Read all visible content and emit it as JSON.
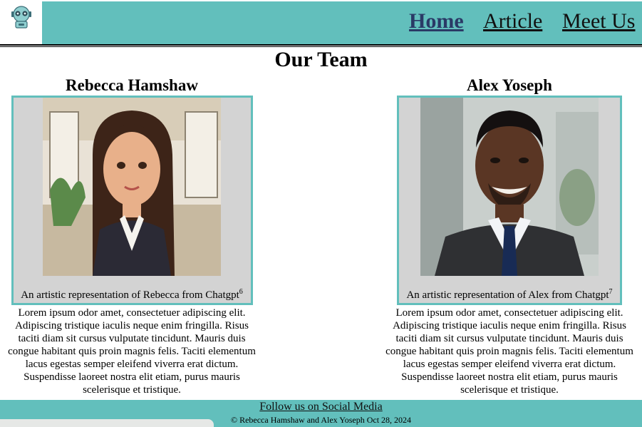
{
  "nav": {
    "items": [
      {
        "label": "Home",
        "active": true
      },
      {
        "label": "Article",
        "active": false
      },
      {
        "label": "Meet Us",
        "active": false
      }
    ]
  },
  "logo_icon": "robot-icon",
  "page_title": "Our Team",
  "members": [
    {
      "name": "Rebecca Hamshaw",
      "caption": "An artistic representation of Rebecca from Chatgpt",
      "footnote": "6",
      "bio": "Lorem ipsum odor amet, consectetuer adipiscing elit. Adipiscing tristique iaculis neque enim fringilla. Risus taciti diam sit cursus vulputate tincidunt. Mauris duis congue habitant quis proin magnis felis. Taciti elementum lacus egestas semper eleifend viverra erat dictum. Suspendisse laoreet nostra elit etiam, purus mauris scelerisque et tristique."
    },
    {
      "name": "Alex Yoseph",
      "caption": "An artistic representation of Alex from Chatgpt",
      "footnote": "7",
      "bio": "Lorem ipsum odor amet, consectetuer adipiscing elit. Adipiscing tristique iaculis neque enim fringilla. Risus taciti diam sit cursus vulputate tincidunt. Mauris duis congue habitant quis proin magnis felis. Taciti elementum lacus egestas semper eleifend viverra erat dictum. Suspendisse laoreet nostra elit etiam, purus mauris scelerisque et tristique."
    }
  ],
  "footer": {
    "social_link": "Follow us on Social Media",
    "copyright": "© Rebecca Hamshaw and Alex Yoseph Oct 28, 2024"
  },
  "colors": {
    "accent": "#62bfbc",
    "figure_bg": "#d3d3d3"
  }
}
